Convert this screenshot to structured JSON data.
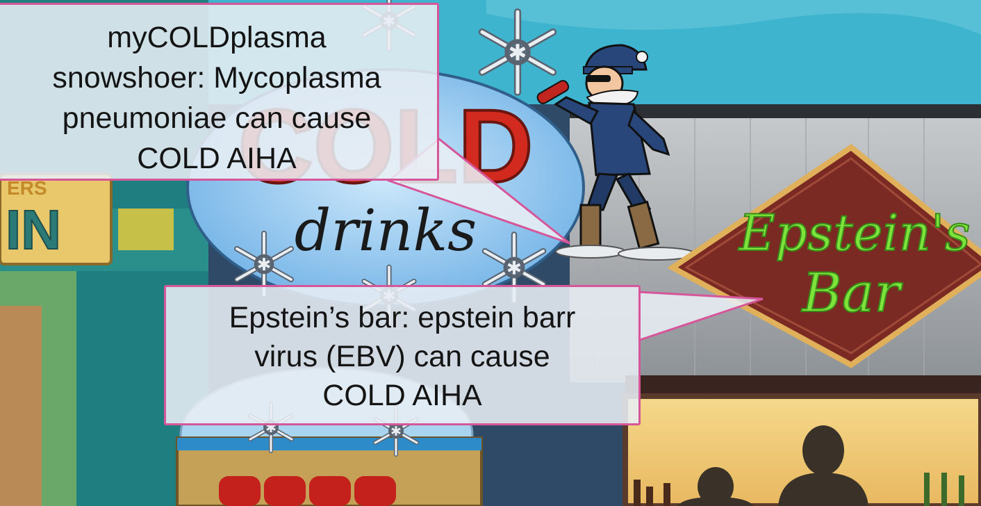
{
  "scene": {
    "sign_cold": "COLD",
    "sign_drinks": "drinks",
    "sign_bar_line1": "Epstein's",
    "sign_bar_line2": "Bar",
    "sign_left_fragment": "IN",
    "sign_left_fragment_top": "ERS",
    "colors": {
      "sky": "#3fb4cf",
      "wall_teal": "#1f7f80",
      "callout_border": "#d6569a",
      "neon_green": "#7de33a",
      "cold_red": "#d22a1f",
      "bar_diamond": "#7a2a22"
    }
  },
  "callouts": [
    {
      "lines": [
        "myCOLDplasma",
        "snowshoer: Mycoplasma",
        "pneumoniae can cause",
        "COLD AIHA"
      ]
    },
    {
      "lines": [
        "Epstein’s bar: epstein barr",
        "virus (EBV) can cause",
        "COLD AIHA"
      ]
    }
  ]
}
